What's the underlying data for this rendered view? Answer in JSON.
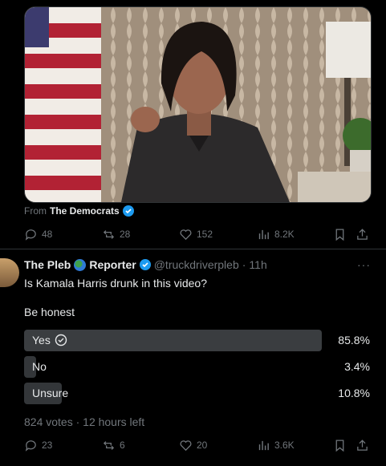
{
  "media": {
    "source_prefix": "From",
    "source_name": "The Democrats"
  },
  "video_actions": {
    "replies": "48",
    "reposts": "28",
    "likes": "152",
    "views": "8.2K"
  },
  "post": {
    "author_name_part1": "The Pleb",
    "author_name_part2": "Reporter",
    "handle": "@truckdriverpleb",
    "separator": "·",
    "time": "11h",
    "more": "···",
    "line1": "Is Kamala Harris drunk in this video?",
    "line2": "Be honest"
  },
  "poll": {
    "options": [
      {
        "label": "Yes",
        "percent": "85.8%",
        "fraction": 0.858,
        "winner": true
      },
      {
        "label": "No",
        "percent": "3.4%",
        "fraction": 0.034,
        "winner": false
      },
      {
        "label": "Unsure",
        "percent": "10.8%",
        "fraction": 0.108,
        "winner": false
      }
    ],
    "meta": "824 votes · 12 hours left"
  },
  "post_actions": {
    "replies": "23",
    "reposts": "6",
    "likes": "20",
    "views": "3.6K"
  },
  "colors": {
    "accent": "#1d9bf0",
    "muted": "#71767b",
    "divider": "#2f3336"
  }
}
